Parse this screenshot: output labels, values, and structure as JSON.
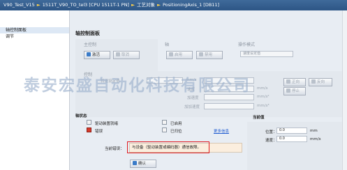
{
  "titlebar": {
    "segments": [
      "V90_Test_V15",
      "1511T_V90_TO_tel3 [CPU 1511T-1 PN]",
      "工艺对象",
      "PositioningAxis_1 [DB11]"
    ],
    "separator": "►"
  },
  "nav": {
    "items": [
      {
        "label": "轴控制面板",
        "active": true
      },
      {
        "label": "调节",
        "active": false
      }
    ]
  },
  "panel": {
    "title": "轴控制面板"
  },
  "master_control": {
    "label": "主控制",
    "activate_label": "激活",
    "deactivate_label": "取消"
  },
  "axis_group": {
    "label": "轴",
    "enable_label": "启用",
    "disable_label": "禁用"
  },
  "mode_group": {
    "label": "操作模式",
    "mode_value": "速度设定值"
  },
  "control_group": {
    "label": "控制",
    "fields": [
      {
        "label": "转速设定值",
        "value": "",
        "unit": "mm/s"
      },
      {
        "label": "速度",
        "value": "",
        "unit": "mm/s"
      },
      {
        "label": "加速度",
        "value": "",
        "unit": "mm/s²"
      },
      {
        "label": "加加速度",
        "value": "",
        "unit": "mm/s³"
      }
    ],
    "forward_label": "正向",
    "backward_label": "反向",
    "stop_label": "停止"
  },
  "watermark": "泰安宏盛自动化科技有限公司",
  "axis_status": {
    "label": "轴状态",
    "items": [
      {
        "label": "驱动装置就绪",
        "state": "off"
      },
      {
        "label": "已启用",
        "state": "off"
      },
      {
        "label": "错误",
        "state": "red"
      },
      {
        "label": "已归位",
        "state": "off"
      }
    ],
    "more_info_label": "更多信息",
    "current_error_label": "当前错误：",
    "current_error_text": "与设备（驱动装置或编码器）通信故障。",
    "confirm_label": "确认"
  },
  "current_values": {
    "label": "当前值",
    "position_label": "位置：",
    "position_value": "0.0",
    "position_unit": "mm",
    "velocity_label": "速度：",
    "velocity_value": "0.0",
    "velocity_unit": "mm/s"
  },
  "colors": {
    "title_bar": "#2d5686",
    "error_red": "#d83b2c",
    "highlight_frame": "#e0191e",
    "link": "#1f5bd1"
  }
}
